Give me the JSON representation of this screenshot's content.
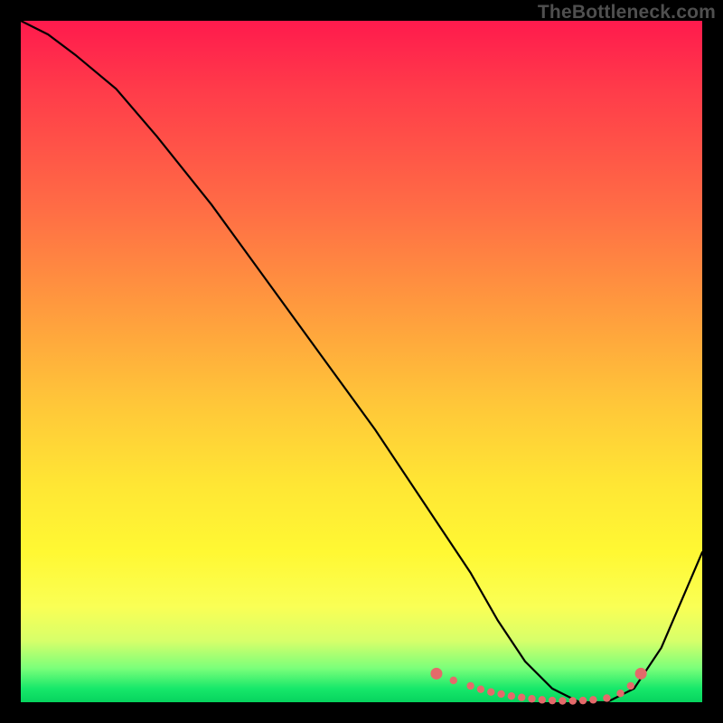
{
  "watermark": "TheBottleneck.com",
  "chart_data": {
    "type": "line",
    "title": "",
    "xlabel": "",
    "ylabel": "",
    "ylim": [
      0,
      100
    ],
    "xlim": [
      0,
      100
    ],
    "series": [
      {
        "name": "bottleneck-curve",
        "x": [
          0,
          4,
          8,
          14,
          20,
          28,
          36,
          44,
          52,
          58,
          62,
          66,
          70,
          74,
          78,
          82,
          86,
          90,
          94,
          100
        ],
        "y": [
          100,
          98,
          95,
          90,
          83,
          73,
          62,
          51,
          40,
          31,
          25,
          19,
          12,
          6,
          2,
          0,
          0,
          2,
          8,
          22
        ]
      }
    ],
    "optimal_markers": {
      "name": "optimal-range-dots",
      "x": [
        61,
        63.5,
        66,
        67.5,
        69,
        70.5,
        72,
        73.5,
        75,
        76.5,
        78,
        79.5,
        81,
        82.5,
        84,
        86,
        88,
        89.5,
        91
      ],
      "y": [
        4.2,
        3.2,
        2.4,
        1.9,
        1.5,
        1.2,
        0.9,
        0.7,
        0.5,
        0.35,
        0.25,
        0.2,
        0.2,
        0.25,
        0.35,
        0.6,
        1.3,
        2.4,
        4.2
      ]
    },
    "colors": {
      "curve": "#000000",
      "markers": "#e46a6a"
    }
  }
}
